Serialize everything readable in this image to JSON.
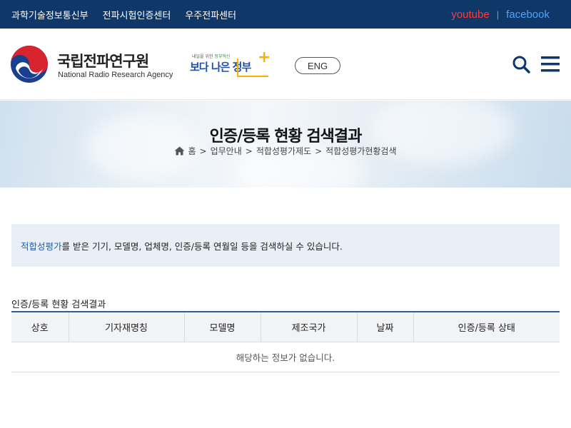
{
  "topbar": {
    "links": [
      "과학기술정보통신부",
      "전파시험인증센터",
      "우주전파센터"
    ],
    "youtube": "youtube",
    "separator": "|",
    "facebook": "facebook"
  },
  "header": {
    "org_name_ko": "국립전파연구원",
    "org_name_en": "National Radio Research Agency",
    "slogan_small_prefix": "내일을 위한 ",
    "slogan_small_highlight": "정부혁신",
    "slogan_big": "보다 나은 정부",
    "eng_label": "ENG",
    "search_icon": "search-icon",
    "menu_icon": "hamburger-menu-icon"
  },
  "banner": {
    "title": "인증/등록 현황 검색결과",
    "breadcrumb": [
      "홈",
      "업무안내",
      "적합성평가제도",
      "적합성평가현황검색"
    ],
    "breadcrumb_sep": ">"
  },
  "notice": {
    "highlight": "적합성평가",
    "text": "를 받은 기기, 모델명, 업체명, 인증/등록 연월일 등을 검색하실 수 있습니다."
  },
  "results": {
    "title": "인증/등록 현황 검색결과",
    "columns": [
      "상호",
      "기자재명칭",
      "모델명",
      "제조국가",
      "날짜",
      "인증/등록 상태"
    ],
    "empty_message": "해당하는 정보가 없습니다."
  },
  "colors": {
    "topbar_bg": "#0f3869",
    "youtube": "#ff3b3b",
    "facebook": "#4ea3ff",
    "accent_blue": "#1f5cad",
    "table_top_border": "#2f5f8f"
  }
}
